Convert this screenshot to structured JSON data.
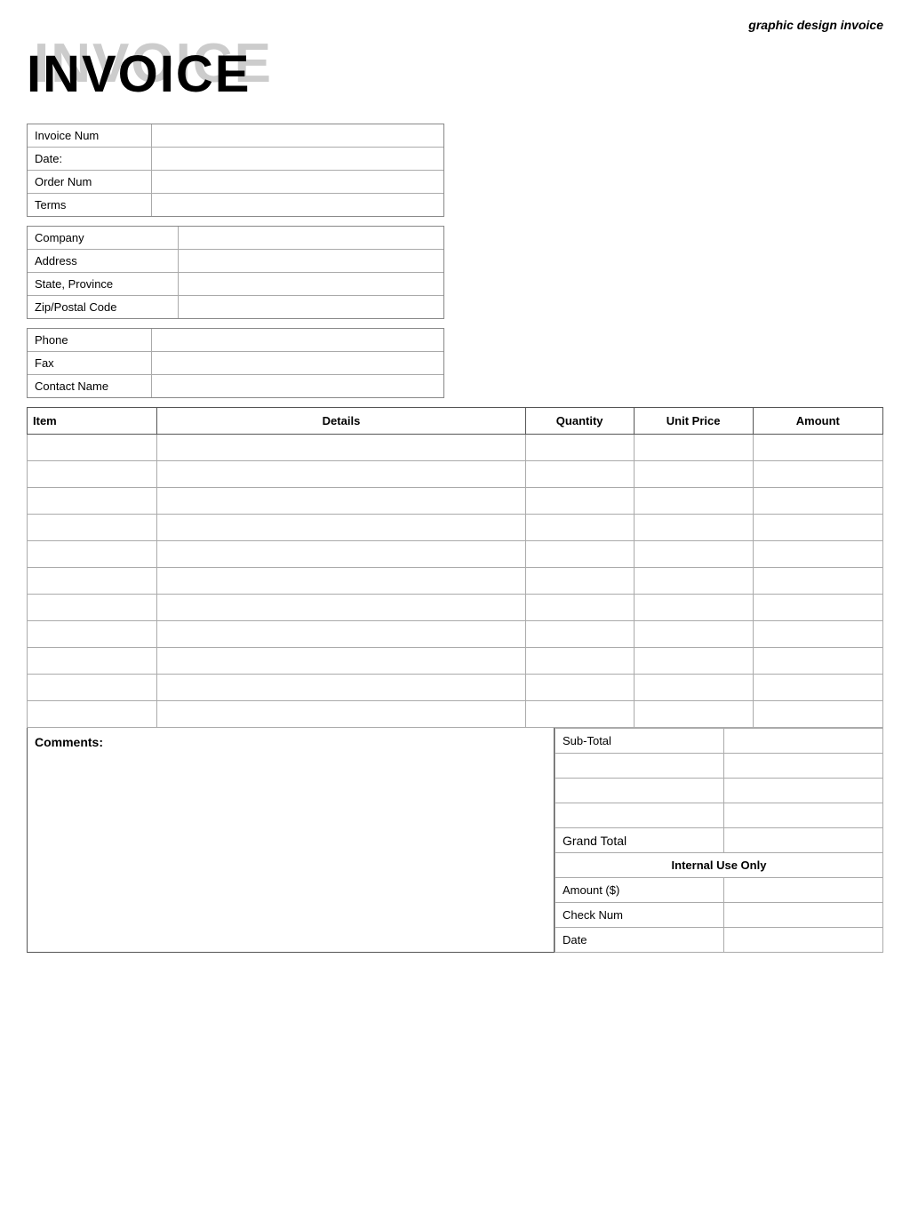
{
  "header": {
    "subtitle": "graphic design invoice",
    "title_shadow": "INVOICE",
    "title_main": "INVOICE"
  },
  "invoice_info": {
    "rows": [
      {
        "label": "Invoice Num",
        "value": ""
      },
      {
        "label": "Date:",
        "value": ""
      },
      {
        "label": "Order Num",
        "value": ""
      },
      {
        "label": "Terms",
        "value": ""
      }
    ]
  },
  "company_info": {
    "rows": [
      {
        "label": "Company",
        "value": ""
      },
      {
        "label": "Address",
        "value": ""
      },
      {
        "label": "State, Province",
        "value": ""
      },
      {
        "label": "Zip/Postal Code",
        "value": ""
      }
    ]
  },
  "contact_info": {
    "rows": [
      {
        "label": "Phone",
        "value": ""
      },
      {
        "label": "Fax",
        "value": ""
      },
      {
        "label": "Contact Name",
        "value": ""
      }
    ]
  },
  "table": {
    "headers": {
      "item": "Item",
      "details": "Details",
      "quantity": "Quantity",
      "unit_price": "Unit Price",
      "amount": "Amount"
    },
    "rows": [
      {
        "item": "",
        "details": "",
        "quantity": "",
        "unit_price": "",
        "amount": ""
      },
      {
        "item": "",
        "details": "",
        "quantity": "",
        "unit_price": "",
        "amount": ""
      },
      {
        "item": "",
        "details": "",
        "quantity": "",
        "unit_price": "",
        "amount": ""
      },
      {
        "item": "",
        "details": "",
        "quantity": "",
        "unit_price": "",
        "amount": ""
      },
      {
        "item": "",
        "details": "",
        "quantity": "",
        "unit_price": "",
        "amount": ""
      },
      {
        "item": "",
        "details": "",
        "quantity": "",
        "unit_price": "",
        "amount": ""
      },
      {
        "item": "",
        "details": "",
        "quantity": "",
        "unit_price": "",
        "amount": ""
      },
      {
        "item": "",
        "details": "",
        "quantity": "",
        "unit_price": "",
        "amount": ""
      },
      {
        "item": "",
        "details": "",
        "quantity": "",
        "unit_price": "",
        "amount": ""
      },
      {
        "item": "",
        "details": "",
        "quantity": "",
        "unit_price": "",
        "amount": ""
      },
      {
        "item": "",
        "details": "",
        "quantity": "",
        "unit_price": "",
        "amount": ""
      }
    ]
  },
  "comments_label": "Comments:",
  "totals": {
    "subtotal_label": "Sub-Total",
    "subtotal_value": "",
    "extra_rows": [
      {
        "label": "",
        "value": ""
      },
      {
        "label": "",
        "value": ""
      },
      {
        "label": "",
        "value": ""
      }
    ],
    "grand_total_label": "Grand Total",
    "grand_total_value": "",
    "internal_header": "Internal Use Only",
    "internal_rows": [
      {
        "label": "Amount ($)",
        "value": ""
      },
      {
        "label": "Check Num",
        "value": ""
      },
      {
        "label": "Date",
        "value": ""
      }
    ]
  }
}
